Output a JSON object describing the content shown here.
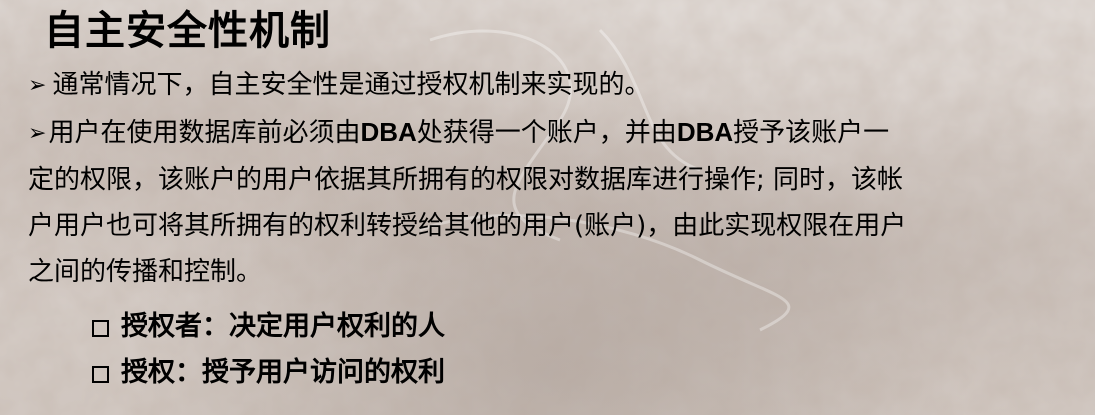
{
  "title": "自主安全性机制",
  "bullets": [
    {
      "marker": "➢",
      "text": "通常情况下，自主安全性是通过授权机制来实现的。"
    },
    {
      "marker": "➢",
      "segments": [
        "用户在使用数据库前必须由",
        "DBA",
        "处获得一个账户，并由",
        "DBA",
        "授予该账户一",
        "定的权限，该账户的用户依据其所拥有的权限对数据库进行操作; 同时，该帐",
        "户用户也可将其所拥有的权利转授给其他的用户(账户)，由此实现权限在用户",
        "之间的传播和控制。"
      ]
    }
  ],
  "sub_items": [
    {
      "text": "授权者：决定用户权利的人"
    },
    {
      "text": "授权：授予用户访问的权利"
    }
  ]
}
